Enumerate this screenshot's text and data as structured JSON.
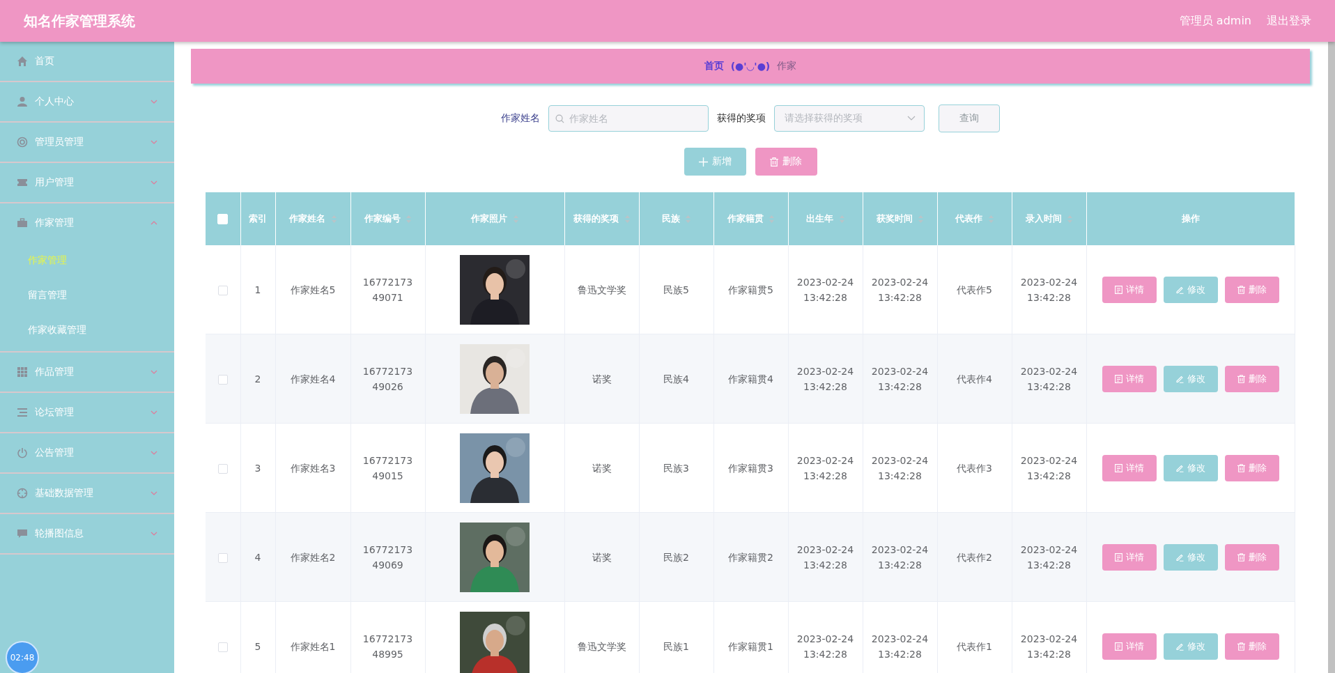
{
  "header": {
    "title": "知名作家管理系统",
    "user": "管理员 admin",
    "logout": "退出登录"
  },
  "sidebar": {
    "items": [
      {
        "label": "首页",
        "kind": "link"
      },
      {
        "label": "个人中心",
        "kind": "menu",
        "expanded": false
      },
      {
        "label": "管理员管理",
        "kind": "menu",
        "expanded": false
      },
      {
        "label": "用户管理",
        "kind": "menu",
        "expanded": false
      },
      {
        "label": "作家管理",
        "kind": "menu",
        "expanded": true,
        "children": [
          {
            "label": "作家管理",
            "selected": true
          },
          {
            "label": "留言管理",
            "selected": false
          },
          {
            "label": "作家收藏管理",
            "selected": false
          }
        ]
      },
      {
        "label": "作品管理",
        "kind": "menu",
        "expanded": false
      },
      {
        "label": "论坛管理",
        "kind": "menu",
        "expanded": false
      },
      {
        "label": "公告管理",
        "kind": "menu",
        "expanded": false
      },
      {
        "label": "基础数据管理",
        "kind": "menu",
        "expanded": false
      },
      {
        "label": "轮播图信息",
        "kind": "menu",
        "expanded": false
      }
    ]
  },
  "clock": "02:48",
  "breadcrumb": {
    "home": "首页",
    "separator": "(●'◡'●)",
    "current": "作家"
  },
  "search": {
    "name_label": "作家姓名",
    "name_placeholder": "作家姓名",
    "award_label": "获得的奖项",
    "award_placeholder": "请选择获得的奖项",
    "query_button": "查询"
  },
  "actions": {
    "add": "新增",
    "delete": "删除"
  },
  "table": {
    "all_checked": false,
    "columns": [
      {
        "label": "索引",
        "sortable": false
      },
      {
        "label": "作家姓名",
        "sortable": true
      },
      {
        "label": "作家编号",
        "sortable": true
      },
      {
        "label": "作家照片",
        "sortable": true
      },
      {
        "label": "获得的奖项",
        "sortable": true
      },
      {
        "label": "民族",
        "sortable": true
      },
      {
        "label": "作家籍贯",
        "sortable": true
      },
      {
        "label": "出生年",
        "sortable": true
      },
      {
        "label": "获奖时间",
        "sortable": true
      },
      {
        "label": "代表作",
        "sortable": true
      },
      {
        "label": "录入时间",
        "sortable": true
      },
      {
        "label": "操作",
        "sortable": false
      }
    ],
    "rows": [
      {
        "checked": false,
        "index": "1",
        "name": "作家姓名5",
        "number": "1677217349071",
        "award": "鲁迅文学奖",
        "ethnicity": "民族5",
        "hometown": "作家籍贯5",
        "birth_year": "2023-02-24 13:42:28",
        "award_time": "2023-02-24 13:42:28",
        "masterpiece": "代表作5",
        "created": "2023-02-24 13:42:28",
        "buttons": [
          "详情",
          "修改",
          "删除"
        ]
      },
      {
        "checked": false,
        "index": "2",
        "name": "作家姓名4",
        "number": "1677217349026",
        "award": "诺奖",
        "ethnicity": "民族4",
        "hometown": "作家籍贯4",
        "birth_year": "2023-02-24 13:42:28",
        "award_time": "2023-02-24 13:42:28",
        "masterpiece": "代表作4",
        "created": "2023-02-24 13:42:28",
        "buttons": [
          "详情",
          "修改",
          "删除"
        ]
      },
      {
        "checked": false,
        "index": "3",
        "name": "作家姓名3",
        "number": "1677217349015",
        "award": "诺奖",
        "ethnicity": "民族3",
        "hometown": "作家籍贯3",
        "birth_year": "2023-02-24 13:42:28",
        "award_time": "2023-02-24 13:42:28",
        "masterpiece": "代表作3",
        "created": "2023-02-24 13:42:28",
        "buttons": [
          "详情",
          "修改",
          "删除"
        ]
      },
      {
        "checked": false,
        "index": "4",
        "name": "作家姓名2",
        "number": "1677217349069",
        "award": "诺奖",
        "ethnicity": "民族2",
        "hometown": "作家籍贯2",
        "birth_year": "2023-02-24 13:42:28",
        "award_time": "2023-02-24 13:42:28",
        "masterpiece": "代表作2",
        "created": "2023-02-24 13:42:28",
        "buttons": [
          "详情",
          "修改",
          "删除"
        ]
      },
      {
        "checked": false,
        "index": "5",
        "name": "作家姓名1",
        "number": "1677217348995",
        "award": "鲁迅文学奖",
        "ethnicity": "民族1",
        "hometown": "作家籍贯1",
        "birth_year": "2023-02-24 13:42:28",
        "award_time": "2023-02-24 13:42:28",
        "masterpiece": "代表作1",
        "created": "2023-02-24 13:42:28",
        "buttons": [
          "详情",
          "修改",
          "删除"
        ]
      }
    ]
  }
}
